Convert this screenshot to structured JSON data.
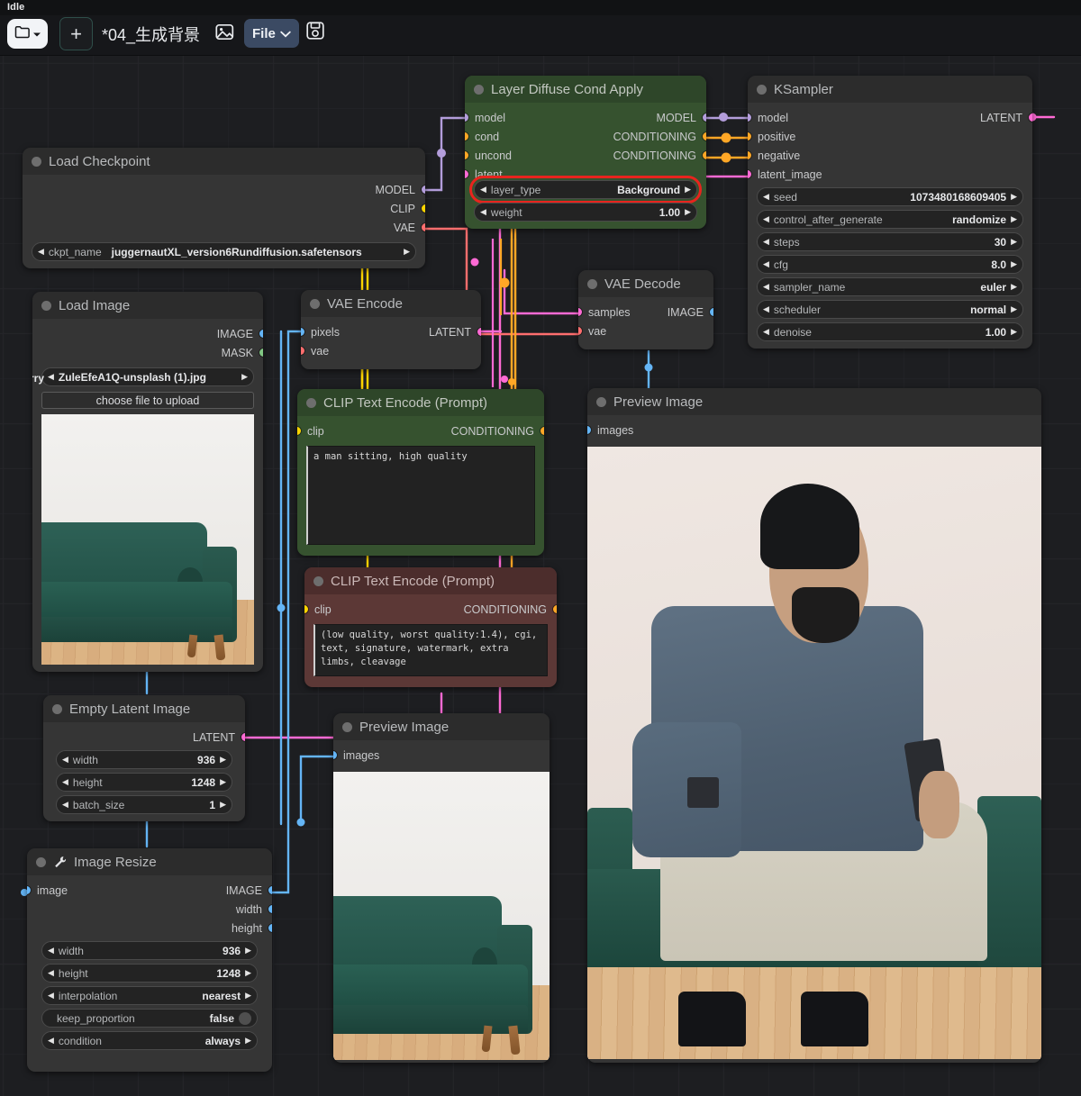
{
  "app": {
    "status": "Idle",
    "toolbar": {
      "folder_icon": "folder-icon",
      "folder_caret": "chevron-down-icon",
      "new_tab_label": "+",
      "workflow_title": "*04_生成背景",
      "image_icon": "image-icon",
      "file_menu_label": "File",
      "file_menu_caret": "chevron-down-icon",
      "save_icon": "floppy-save-icon"
    }
  },
  "colors": {
    "canvas": "#1d1e21",
    "node_dark": "#353535",
    "node_green": "#36522f",
    "node_red": "#5c3836",
    "highlight": "#e8241e",
    "model_link": "#b39ddb",
    "clip_link": "#ffd500",
    "vae_link": "#ff6e6e",
    "conditioning_link": "#ffa726",
    "latent_link": "#ff6ad5",
    "image_link": "#64b5f6",
    "mask_link": "#81c784"
  },
  "nodes": {
    "layer_diffuse": {
      "title": "Layer Diffuse Cond Apply",
      "inputs": [
        {
          "name": "model",
          "color": "#b39ddb"
        },
        {
          "name": "cond",
          "color": "#ffa726"
        },
        {
          "name": "uncond",
          "color": "#ffa726"
        },
        {
          "name": "latent",
          "color": "#ff6ad5"
        }
      ],
      "outputs": [
        {
          "name": "MODEL",
          "color": "#b39ddb"
        },
        {
          "name": "CONDITIONING",
          "color": "#ffa726"
        },
        {
          "name": "CONDITIONING",
          "color": "#ffa726"
        }
      ],
      "widgets": [
        {
          "label": "layer_type",
          "value": "Background",
          "highlighted": true
        },
        {
          "label": "weight",
          "value": "1.00",
          "highlighted": false
        }
      ]
    },
    "ksampler": {
      "title": "KSampler",
      "inputs": [
        {
          "name": "model",
          "color": "#b39ddb"
        },
        {
          "name": "positive",
          "color": "#ffa726"
        },
        {
          "name": "negative",
          "color": "#ffa726"
        },
        {
          "name": "latent_image",
          "color": "#ff6ad5"
        }
      ],
      "outputs": [
        {
          "name": "LATENT",
          "color": "#ff6ad5"
        }
      ],
      "widgets": [
        {
          "label": "seed",
          "value": "1073480168609405"
        },
        {
          "label": "control_after_generate",
          "value": "randomize"
        },
        {
          "label": "steps",
          "value": "30"
        },
        {
          "label": "cfg",
          "value": "8.0"
        },
        {
          "label": "sampler_name",
          "value": "euler"
        },
        {
          "label": "scheduler",
          "value": "normal"
        },
        {
          "label": "denoise",
          "value": "1.00"
        }
      ]
    },
    "load_checkpoint": {
      "title": "Load Checkpoint",
      "outputs": [
        {
          "name": "MODEL",
          "color": "#b39ddb"
        },
        {
          "name": "CLIP",
          "color": "#ffd500"
        },
        {
          "name": "VAE",
          "color": "#ff6e6e"
        }
      ],
      "widgets": [
        {
          "label": "ckpt_name",
          "value": "juggernautXL_version6Rundiffusion.safetensors"
        }
      ]
    },
    "load_image": {
      "title": "Load Image",
      "outputs": [
        {
          "name": "IMAGE",
          "color": "#64b5f6"
        },
        {
          "name": "MASK",
          "color": "#81c784"
        }
      ],
      "widgets": [
        {
          "label": "image",
          "value": "ZuleEfeA1Q-unsplash (1).jpg",
          "overflow_prefix": "-goldsberry"
        }
      ],
      "upload_button": "choose file to upload",
      "preview_alt": "green velvet sofa on wooden floor"
    },
    "vae_encode": {
      "title": "VAE Encode",
      "inputs": [
        {
          "name": "pixels",
          "color": "#64b5f6"
        },
        {
          "name": "vae",
          "color": "#ff6e6e"
        }
      ],
      "outputs": [
        {
          "name": "LATENT",
          "color": "#ff6ad5"
        }
      ]
    },
    "vae_decode": {
      "title": "VAE Decode",
      "inputs": [
        {
          "name": "samples",
          "color": "#ff6ad5"
        },
        {
          "name": "vae",
          "color": "#ff6e6e"
        }
      ],
      "outputs": [
        {
          "name": "IMAGE",
          "color": "#64b5f6"
        }
      ]
    },
    "clip_positive": {
      "title": "CLIP Text Encode (Prompt)",
      "inputs": [
        {
          "name": "clip",
          "color": "#ffd500"
        }
      ],
      "outputs": [
        {
          "name": "CONDITIONING",
          "color": "#ffa726"
        }
      ],
      "text": "a man sitting, high quality"
    },
    "clip_negative": {
      "title": "CLIP Text Encode (Prompt)",
      "inputs": [
        {
          "name": "clip",
          "color": "#ffd500"
        }
      ],
      "outputs": [
        {
          "name": "CONDITIONING",
          "color": "#ffa726"
        }
      ],
      "text": "(low quality, worst quality:1.4), cgi, text, signature, watermark, extra limbs, cleavage"
    },
    "empty_latent": {
      "title": "Empty Latent Image",
      "outputs": [
        {
          "name": "LATENT",
          "color": "#ff6ad5"
        }
      ],
      "widgets": [
        {
          "label": "width",
          "value": "936"
        },
        {
          "label": "height",
          "value": "1248"
        },
        {
          "label": "batch_size",
          "value": "1"
        }
      ]
    },
    "image_resize": {
      "title": "Image Resize",
      "title_icon": "wrench-icon",
      "inputs": [
        {
          "name": "image",
          "color": "#64b5f6"
        }
      ],
      "outputs": [
        {
          "name": "IMAGE",
          "color": "#64b5f6"
        },
        {
          "name": "width",
          "color": "#64b5f6"
        },
        {
          "name": "height",
          "color": "#64b5f6"
        }
      ],
      "widgets": [
        {
          "label": "width",
          "value": "936",
          "type": "number"
        },
        {
          "label": "height",
          "value": "1248",
          "type": "number"
        },
        {
          "label": "interpolation",
          "value": "nearest",
          "type": "combo"
        },
        {
          "label": "keep_proportion",
          "value": "false",
          "type": "toggle"
        },
        {
          "label": "condition",
          "value": "always",
          "type": "combo"
        }
      ]
    },
    "preview_main": {
      "title": "Preview Image",
      "inputs": [
        {
          "name": "images",
          "color": "#64b5f6"
        }
      ],
      "preview_alt": "man in blue shirt sitting on green sofa holding a phone"
    },
    "preview_small": {
      "title": "Preview Image",
      "inputs": [
        {
          "name": "images",
          "color": "#64b5f6"
        }
      ],
      "preview_alt": "green velvet sofa on wooden floor"
    }
  }
}
